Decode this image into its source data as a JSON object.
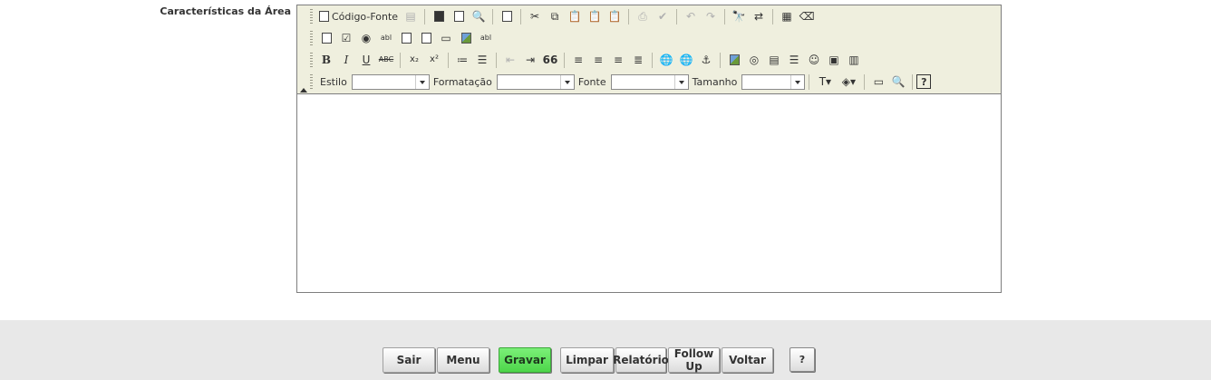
{
  "field": {
    "label": "Características da Área"
  },
  "toolbar": {
    "source_label": "Código-Fonte",
    "style_label": "Estilo",
    "format_label": "Formatação",
    "font_label": "Fonte",
    "size_label": "Tamanho",
    "style_value": "",
    "format_value": "",
    "font_value": "",
    "size_value": "",
    "bold": "B",
    "italic": "I",
    "underline": "U",
    "strike": "ABC",
    "abl": "abl",
    "quote": "66",
    "help": "?"
  },
  "editor": {
    "content": ""
  },
  "footer": {
    "buttons": [
      {
        "label": "Sair"
      },
      {
        "label": "Menu"
      },
      {
        "label": "Gravar"
      },
      {
        "label": "Limpar"
      },
      {
        "label": "Relatório"
      },
      {
        "label": "Follow Up"
      },
      {
        "label": "Voltar"
      }
    ],
    "help_label": "?"
  },
  "colors": {
    "toolbar_bg": "#efefde",
    "footer_bg": "#e8e8e8",
    "save_button": "#5ce05a"
  }
}
